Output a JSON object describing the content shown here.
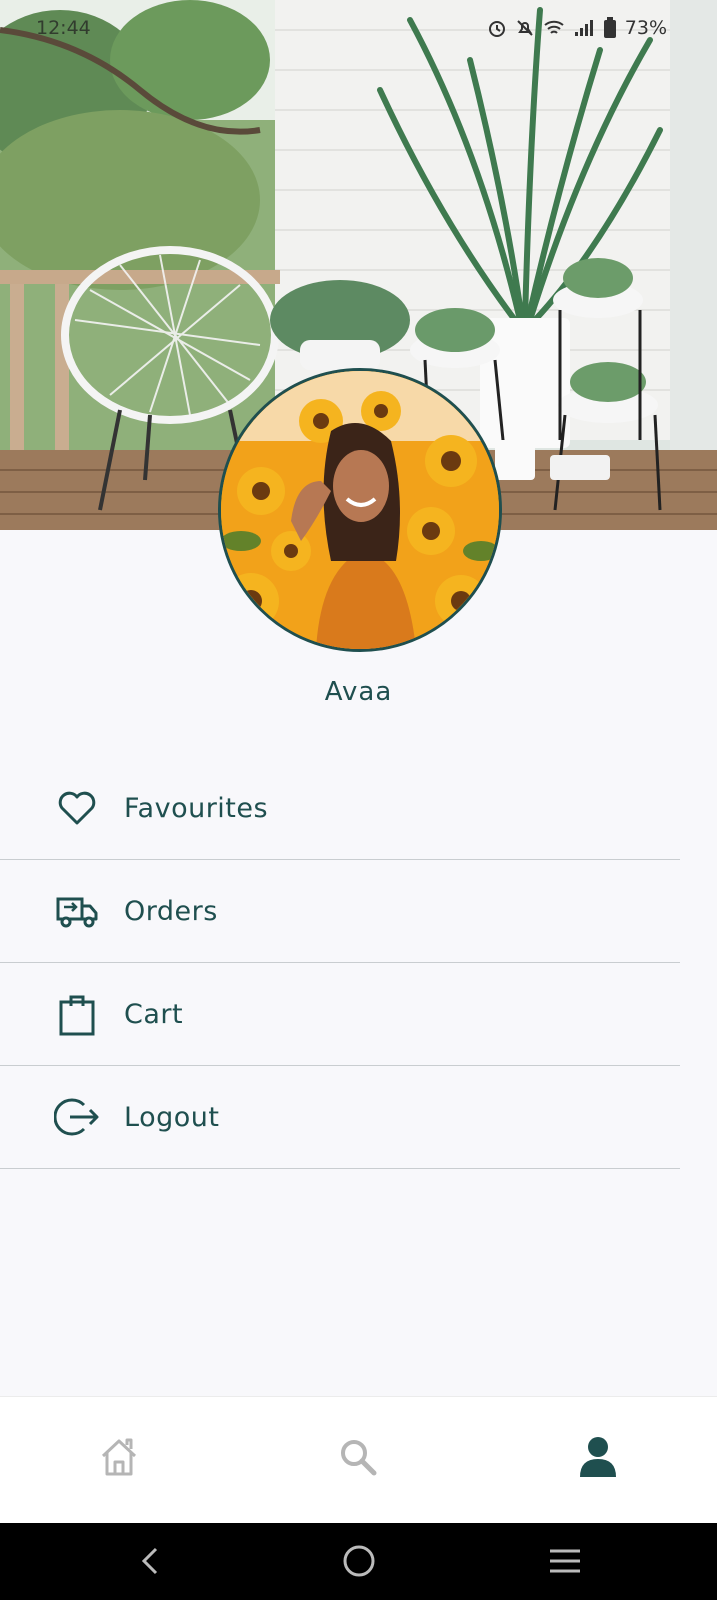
{
  "status_bar": {
    "time": "12:44",
    "battery": "73%",
    "icons": [
      "alarm-icon",
      "mute-icon",
      "wifi-icon",
      "signal-icon",
      "battery-icon"
    ]
  },
  "profile": {
    "name": "Avaa"
  },
  "menu": {
    "items": [
      {
        "label": "Favourites",
        "icon": "heart-icon"
      },
      {
        "label": "Orders",
        "icon": "delivery-truck-icon"
      },
      {
        "label": "Cart",
        "icon": "shopping-bag-icon"
      },
      {
        "label": "Logout",
        "icon": "logout-icon"
      }
    ]
  },
  "bottom_nav": {
    "items": [
      {
        "icon": "home-icon",
        "active": false
      },
      {
        "icon": "search-icon",
        "active": false
      },
      {
        "icon": "profile-icon",
        "active": true
      }
    ]
  },
  "colors": {
    "accent": "#1f4f4f",
    "inactive": "#b5b5b5",
    "background": "#f8f8fb",
    "divider": "#c9cdd0"
  }
}
